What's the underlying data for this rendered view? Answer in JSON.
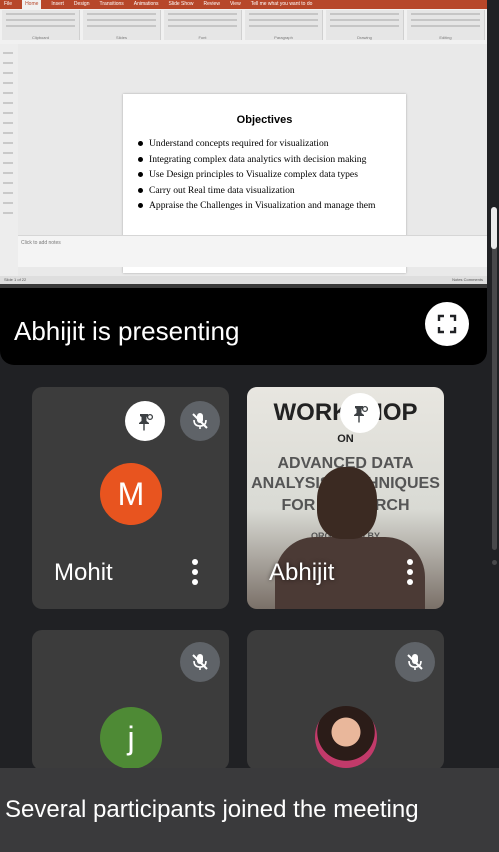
{
  "presentation": {
    "ribbon_tabs": [
      "File",
      "Home",
      "Insert",
      "Design",
      "Transitions",
      "Animations",
      "Slide Show",
      "Review",
      "View",
      "Tell me what you want to do"
    ],
    "ribbon_groups": [
      "Clipboard",
      "Slides",
      "Font",
      "Paragraph",
      "Drawing",
      "Editing"
    ],
    "slide": {
      "title": "Objectives",
      "bullets": [
        "Understand concepts required for visualization",
        "Integrating complex data analytics with decision making",
        "Use Design principles to Visualize complex data types",
        "Carry out Real time data visualization",
        "Appraise the Challenges in Visualization and manage them"
      ]
    },
    "notes_placeholder": "Click to add notes",
    "status_left": "Slide 1 of 22",
    "status_right": "Notes  Comments"
  },
  "presenting_label": "Abhijit is presenting",
  "participants": [
    {
      "name": "Mohit",
      "initial": "M",
      "avatar_color": "#e8541f",
      "pinned": true,
      "muted": true
    },
    {
      "name": "Abhijit",
      "pinned": true,
      "muted": false,
      "video": true,
      "banner": {
        "line1": "WORKSHOP",
        "line2": "ON",
        "line3": "ADVANCED DATA",
        "line4": "ANALYSIS TECHNIQUES",
        "line5": "FOR RESEARCH",
        "line6": "ORGANIZED BY"
      }
    },
    {
      "name": "",
      "initial": "j",
      "avatar_color": "#4e8a35",
      "muted": true
    },
    {
      "name": "",
      "muted": true,
      "photo_avatar": true
    }
  ],
  "notification": "Several participants joined the meeting",
  "colors": {
    "background": "#202124",
    "tile": "#3c3c3c",
    "toast": "#3a3a3c"
  }
}
